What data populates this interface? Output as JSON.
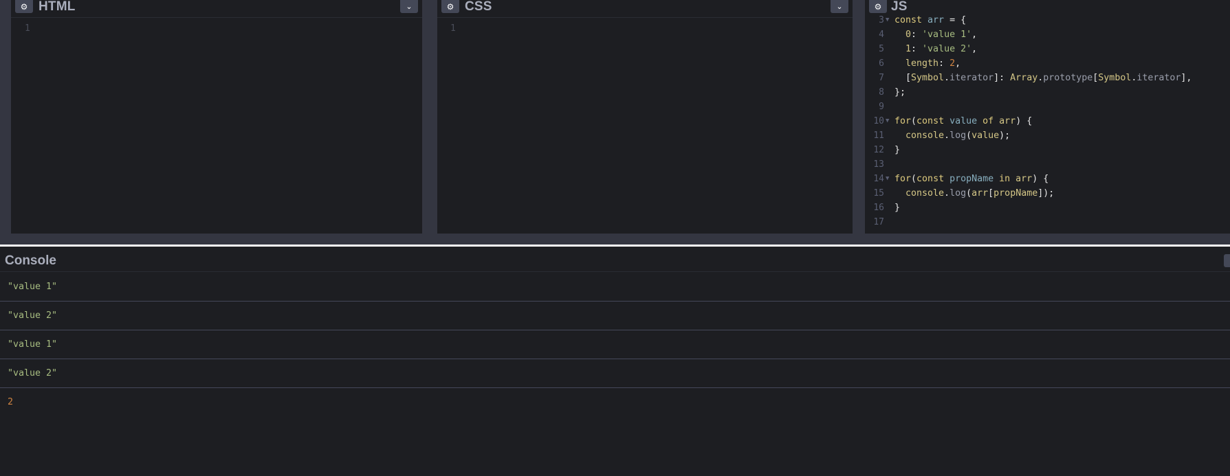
{
  "editors": {
    "html": {
      "title": "HTML",
      "line_numbers": [
        "1"
      ]
    },
    "css": {
      "title": "CSS",
      "line_numbers": [
        "1"
      ]
    },
    "js": {
      "title": "JS",
      "line_numbers": [
        "3",
        "4",
        "5",
        "6",
        "7",
        "8",
        "9",
        "10",
        "11",
        "12",
        "13",
        "14",
        "15",
        "16",
        "17"
      ]
    },
    "settings_icon": "gear-icon",
    "collapse_icon": "chevron-down-icon"
  },
  "js_code": [
    [
      [
        "kw",
        "const "
      ],
      [
        "var",
        "arr"
      ],
      [
        "plain",
        " = {"
      ]
    ],
    [
      [
        "plain",
        "  "
      ],
      [
        "prop",
        "0"
      ],
      [
        "plain",
        ": "
      ],
      [
        "str",
        "'value 1'"
      ],
      [
        "plain",
        ","
      ]
    ],
    [
      [
        "plain",
        "  "
      ],
      [
        "prop",
        "1"
      ],
      [
        "plain",
        ": "
      ],
      [
        "str",
        "'value 2'"
      ],
      [
        "plain",
        ","
      ]
    ],
    [
      [
        "plain",
        "  "
      ],
      [
        "prop",
        "length"
      ],
      [
        "plain",
        ": "
      ],
      [
        "num",
        "2"
      ],
      [
        "plain",
        ","
      ]
    ],
    [
      [
        "plain",
        "  ["
      ],
      [
        "prop",
        "Symbol"
      ],
      [
        "plain",
        "."
      ],
      [
        "fn",
        "iterator"
      ],
      [
        "plain",
        "]: "
      ],
      [
        "prop",
        "Array"
      ],
      [
        "plain",
        "."
      ],
      [
        "fn",
        "prototype"
      ],
      [
        "plain",
        "["
      ],
      [
        "prop",
        "Symbol"
      ],
      [
        "plain",
        "."
      ],
      [
        "fn",
        "iterator"
      ],
      [
        "plain",
        "],"
      ]
    ],
    [
      [
        "plain",
        "};"
      ]
    ],
    [
      [
        "plain",
        ""
      ]
    ],
    [
      [
        "kw",
        "for"
      ],
      [
        "plain",
        "("
      ],
      [
        "kw",
        "const "
      ],
      [
        "var",
        "value"
      ],
      [
        "kw",
        " of "
      ],
      [
        "prop",
        "arr"
      ],
      [
        "plain",
        ") {"
      ]
    ],
    [
      [
        "plain",
        "  "
      ],
      [
        "prop",
        "console"
      ],
      [
        "plain",
        "."
      ],
      [
        "fn",
        "log"
      ],
      [
        "plain",
        "("
      ],
      [
        "prop",
        "value"
      ],
      [
        "plain",
        ");"
      ]
    ],
    [
      [
        "plain",
        "}"
      ]
    ],
    [
      [
        "plain",
        ""
      ]
    ],
    [
      [
        "kw",
        "for"
      ],
      [
        "plain",
        "("
      ],
      [
        "kw",
        "const "
      ],
      [
        "var",
        "propName"
      ],
      [
        "kw",
        " in "
      ],
      [
        "prop",
        "arr"
      ],
      [
        "plain",
        ") {"
      ]
    ],
    [
      [
        "plain",
        "  "
      ],
      [
        "prop",
        "console"
      ],
      [
        "plain",
        "."
      ],
      [
        "fn",
        "log"
      ],
      [
        "plain",
        "("
      ],
      [
        "prop",
        "arr"
      ],
      [
        "plain",
        "["
      ],
      [
        "prop",
        "propName"
      ],
      [
        "plain",
        "]);"
      ]
    ],
    [
      [
        "plain",
        "}"
      ]
    ],
    [
      [
        "plain",
        ""
      ]
    ]
  ],
  "console": {
    "title": "Console",
    "entries": [
      {
        "text": "\"value 1\"",
        "kind": "string"
      },
      {
        "text": "\"value 2\"",
        "kind": "string"
      },
      {
        "text": "\"value 1\"",
        "kind": "string"
      },
      {
        "text": "\"value 2\"",
        "kind": "string"
      },
      {
        "text": "2",
        "kind": "number"
      }
    ]
  }
}
